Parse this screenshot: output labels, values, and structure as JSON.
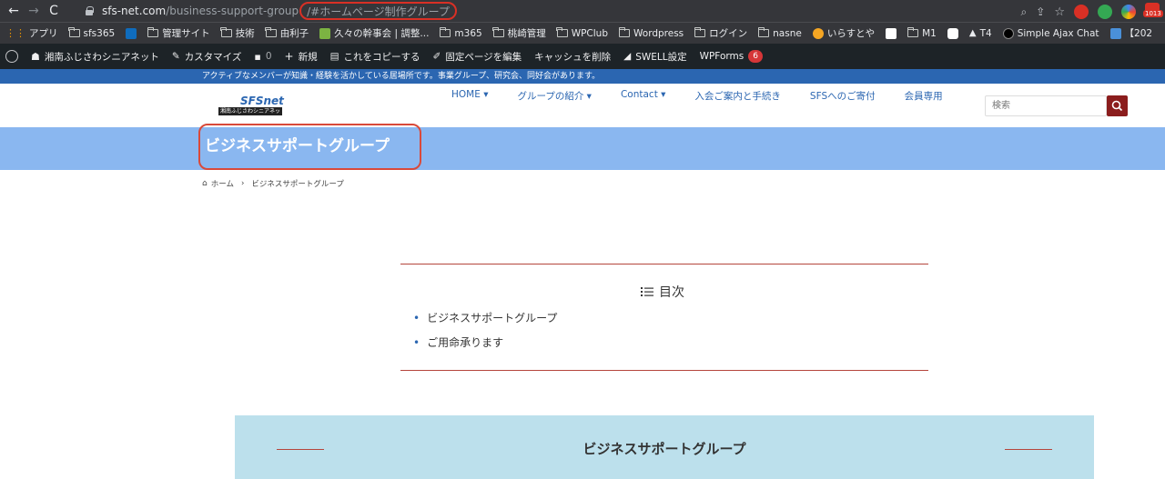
{
  "browser": {
    "url_host": "sfs-net.com",
    "url_path": "/business-support-group",
    "url_hash": "/#ホームページ制作グループ",
    "mail_count": "1013",
    "overflow": "【202"
  },
  "bookmarks": [
    {
      "label": "アプリ",
      "icon": "apps-grid-icon"
    },
    {
      "label": "sfs365",
      "icon": "folder-icon"
    },
    {
      "label": "",
      "icon": "outlook-icon"
    },
    {
      "label": "管理サイト",
      "icon": "folder-icon"
    },
    {
      "label": "技術",
      "icon": "folder-icon"
    },
    {
      "label": "由利子",
      "icon": "folder-icon"
    },
    {
      "label": "久々の幹事会 | 調整...",
      "icon": "green-doc-icon"
    },
    {
      "label": "m365",
      "icon": "folder-icon"
    },
    {
      "label": "桃崎管理",
      "icon": "folder-icon"
    },
    {
      "label": "WPClub",
      "icon": "folder-icon"
    },
    {
      "label": "Wordpress",
      "icon": "folder-icon"
    },
    {
      "label": "ログイン",
      "icon": "folder-icon"
    },
    {
      "label": "nasne",
      "icon": "folder-icon"
    },
    {
      "label": "いらすとや",
      "icon": "irasutoya-icon"
    },
    {
      "label": "",
      "icon": "amazon-icon"
    },
    {
      "label": "M1",
      "icon": "folder-icon"
    },
    {
      "label": "",
      "icon": "box-icon"
    },
    {
      "label": "T4",
      "icon": "triangle-icon"
    },
    {
      "label": "Simple Ajax Chat",
      "icon": "chat-icon"
    }
  ],
  "wp_admin": {
    "site_name": "湘南ふじさわシニアネット",
    "customize": "カスタマイズ",
    "comments": "0",
    "new": "新規",
    "copy": "これをコピーする",
    "edit_page": "固定ページを編集",
    "clear_cache": "キャッシュを削除",
    "swell": "SWELL設定",
    "wpforms": "WPForms",
    "wpforms_count": "6"
  },
  "notice": "アクティブなメンバーが知識・経験を活かしている居場所です。事業グループ、研究会、同好会があります。",
  "logo": {
    "main": "SFSnet",
    "sub": "湘南ふじさわシニアネット"
  },
  "menu": [
    {
      "label": "HOME ▾"
    },
    {
      "label": "グループの紹介 ▾"
    },
    {
      "label": "Contact ▾"
    },
    {
      "label": "入会ご案内と手続き"
    },
    {
      "label": "SFSへのご寄付"
    },
    {
      "label": "会員専用"
    }
  ],
  "search": {
    "placeholder": "検索"
  },
  "page": {
    "title": "ビジネスサポートグループ"
  },
  "breadcrumb": {
    "home": "ホーム",
    "current": "ビジネスサポートグループ"
  },
  "toc": {
    "title": "目次",
    "items": [
      "ビジネスサポートグループ",
      "ご用命承ります"
    ]
  },
  "section": {
    "title": "ビジネスサポートグループ"
  },
  "colors": {
    "accent": "#2b66b1",
    "title_band": "#8ab7f0",
    "section_bg": "#bce0ec",
    "search_btn": "#8b1d1d"
  }
}
